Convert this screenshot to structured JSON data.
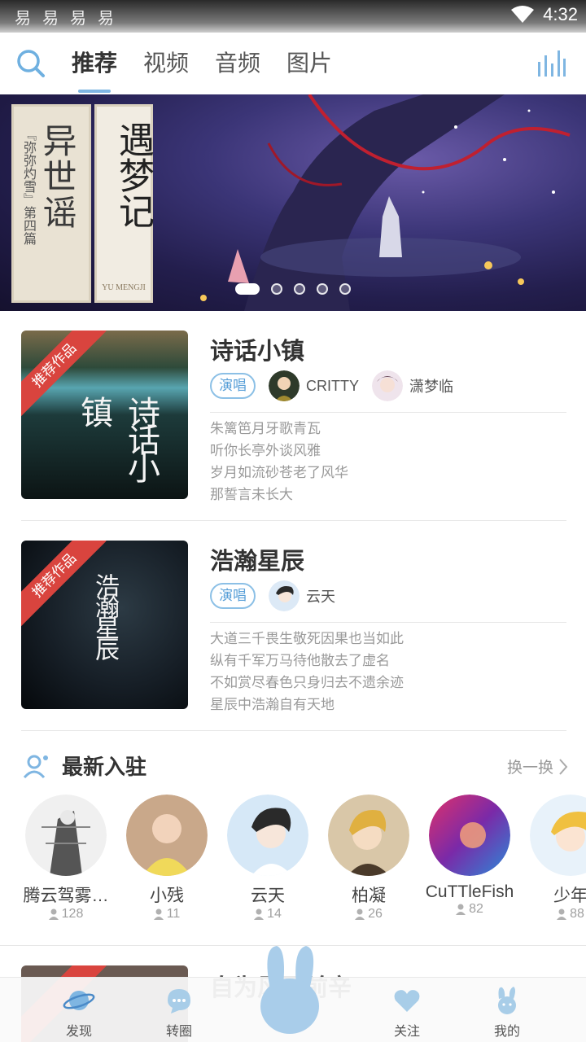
{
  "status_bar": {
    "notifications": [
      "易",
      "易",
      "易",
      "易"
    ],
    "time": "4:32"
  },
  "top_nav": {
    "tabs": [
      {
        "label": "推荐",
        "active": true
      },
      {
        "label": "视频",
        "active": false
      },
      {
        "label": "音频",
        "active": false
      },
      {
        "label": "图片",
        "active": false
      }
    ]
  },
  "banner": {
    "poster1_title": "异世谣",
    "poster1_subtitle": "『弥弥灼雪』第四篇",
    "poster2_title": "遇梦记",
    "poster2_caption": "YU MENGJI",
    "page_count": 5,
    "active_index": 0
  },
  "works": [
    {
      "badge": "推荐作品",
      "title": "诗话小镇",
      "cover_text": "诗话小镇",
      "role": "演唱",
      "singers": [
        "CRITTY",
        "潇梦临"
      ],
      "lyrics": [
        "朱篱笆月牙歌青瓦",
        "听你长亭外谈风雅",
        "岁月如流砂苍老了风华",
        "那誓言未长大"
      ]
    },
    {
      "badge": "推荐作品",
      "title": "浩瀚星辰",
      "cover_text": "浩瀚星辰",
      "role": "演唱",
      "singers": [
        "云天"
      ],
      "lyrics": [
        "大道三千畏生敬死因果也当如此",
        "纵有千军万马待他散去了虚名",
        "不如赏尽春色只身归去不遗余迹",
        "星辰中浩瀚自有天地"
      ]
    }
  ],
  "newcomers": {
    "title": "最新入驻",
    "refresh_label": "换一换",
    "users": [
      {
        "name": "腾云驾雾…",
        "fans": "128"
      },
      {
        "name": "小残",
        "fans": "11"
      },
      {
        "name": "云天",
        "fans": "14"
      },
      {
        "name": "柏凝",
        "fans": "26"
      },
      {
        "name": "CuTTleFish",
        "fans": "82"
      },
      {
        "name": "少年",
        "fans": "88"
      }
    ]
  },
  "work3": {
    "title": "自为风雨前辛"
  },
  "bottom_tabs": [
    {
      "label": "发现",
      "icon": "planet-icon"
    },
    {
      "label": "转圈",
      "icon": "chat-bubble-icon"
    },
    {
      "label": "关注",
      "icon": "heart-icon"
    },
    {
      "label": "我的",
      "icon": "bunny-icon"
    }
  ],
  "colors": {
    "accent": "#7fb6e2",
    "ribbon": "#d9443e"
  }
}
